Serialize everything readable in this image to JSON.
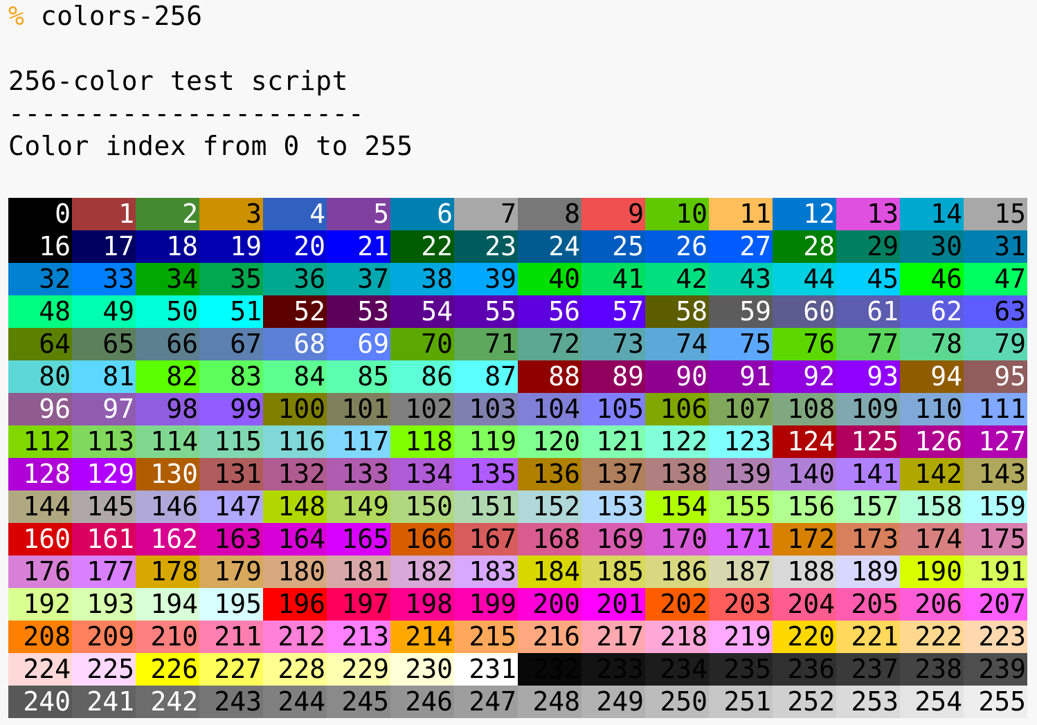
{
  "terminal": {
    "prompt_symbol": "%",
    "command": "colors-256",
    "heading": "256-color test script",
    "rule": "----------------------",
    "subheading": "Color index from 0 to 255"
  },
  "palette": {
    "prompt_color": "#f5a623",
    "colors": [
      "#000000",
      "#a33a3a",
      "#448a30",
      "#cc9000",
      "#3060c0",
      "#8040a0",
      "#0080b0",
      "#a8a8a8",
      "#787878",
      "#f05050",
      "#60c800",
      "#ffbe5a",
      "#0078d0",
      "#e050e0",
      "#00a8d0",
      "#a8a8a8",
      "#000000",
      "#000060",
      "#000098",
      "#0000b0",
      "#0000d8",
      "#0000ff",
      "#005c00",
      "#005c5c",
      "#005c90",
      "#005cc0",
      "#005ce0",
      "#005cff",
      "#008000",
      "#008060",
      "#008090",
      "#0080b0",
      "#0080d0",
      "#0080ff",
      "#00a800",
      "#00a850",
      "#00a890",
      "#00a8b0",
      "#00a8e0",
      "#00a8ff",
      "#00e000",
      "#00e060",
      "#00e080",
      "#00d0b0",
      "#00d0e0",
      "#00d0ff",
      "#00ff00",
      "#00ff60",
      "#00ff80",
      "#00ffb0",
      "#00ffd8",
      "#00ffff",
      "#5c0000",
      "#5c005c",
      "#5c0090",
      "#5c00b0",
      "#5c00e0",
      "#5c00ff",
      "#5c5c00",
      "#5c5c5c",
      "#5c5c90",
      "#5c5cb0",
      "#5c5ce0",
      "#5c5cff",
      "#5c8000",
      "#5c805c",
      "#5c8090",
      "#5c80b0",
      "#5c80d8",
      "#5c80ff",
      "#5ca800",
      "#5ca85c",
      "#5ca890",
      "#5ca8b0",
      "#5ca8d8",
      "#5ca8ff",
      "#5cd800",
      "#5cd85c",
      "#5cd890",
      "#5cd8b0",
      "#5cd8d8",
      "#5cd8ff",
      "#5cff00",
      "#5cff5c",
      "#5cff90",
      "#5cffb0",
      "#5cffd8",
      "#5cffff",
      "#900000",
      "#90005c",
      "#900090",
      "#9000b0",
      "#9000e0",
      "#9000ff",
      "#905c00",
      "#905c5c",
      "#905c90",
      "#905cb0",
      "#905ce0",
      "#905cff",
      "#808000",
      "#80805c",
      "#808080",
      "#8080b0",
      "#8080d8",
      "#8080ff",
      "#80a800",
      "#80a85c",
      "#80a880",
      "#80a8b0",
      "#80a8d8",
      "#80a8ff",
      "#80d800",
      "#80d85c",
      "#80d890",
      "#80d8b0",
      "#80d8d8",
      "#80d8ff",
      "#80ff00",
      "#80ff5c",
      "#80ff90",
      "#80ffb0",
      "#80ffd8",
      "#80ffff",
      "#b00000",
      "#b0005c",
      "#b00090",
      "#b000b0",
      "#b000d8",
      "#b000ff",
      "#b05c00",
      "#b05c5c",
      "#b05c90",
      "#b05cb0",
      "#b05cd8",
      "#b05cff",
      "#b08000",
      "#b0805c",
      "#b08080",
      "#b080b0",
      "#b080d8",
      "#b080ff",
      "#b0a800",
      "#b0a85c",
      "#b0a880",
      "#b0a8a8",
      "#b0a8d8",
      "#b0a8ff",
      "#b0d800",
      "#b0d85c",
      "#b0d880",
      "#b0d8b0",
      "#b0d8d8",
      "#b0d8ff",
      "#b0ff00",
      "#b0ff5c",
      "#b0ff90",
      "#b0ffb0",
      "#b0ffd8",
      "#b0ffff",
      "#d80000",
      "#d8005c",
      "#d80090",
      "#d800b0",
      "#d800d8",
      "#d800ff",
      "#d85c00",
      "#d85c5c",
      "#d85c90",
      "#d85cb0",
      "#d85cd8",
      "#d85cff",
      "#d88000",
      "#d8805c",
      "#d88080",
      "#d880b0",
      "#d880d8",
      "#d880ff",
      "#d8a800",
      "#d8a85c",
      "#d8a880",
      "#d8a8a8",
      "#d8a8d8",
      "#d8a8ff",
      "#d8d800",
      "#d8d85c",
      "#d8d880",
      "#d8d8b0",
      "#d8d8d8",
      "#d8d8ff",
      "#d8ff00",
      "#d8ff5c",
      "#d8ff90",
      "#d8ffb0",
      "#d8ffd8",
      "#d8ffff",
      "#ff0000",
      "#ff005c",
      "#ff0090",
      "#ff00b0",
      "#ff00d8",
      "#ff00ff",
      "#ff5c00",
      "#ff5c5c",
      "#ff5c90",
      "#ff5cb0",
      "#ff5cd8",
      "#ff5cff",
      "#ff8000",
      "#ff805c",
      "#ff8080",
      "#ff80b0",
      "#ff80d8",
      "#ff80ff",
      "#ffa800",
      "#ffa85c",
      "#ffa880",
      "#ffa8b0",
      "#ffa8d8",
      "#ffa8ff",
      "#ffd800",
      "#ffd85c",
      "#ffd890",
      "#ffd8b0",
      "#ffd8d8",
      "#ffd8ff",
      "#ffff00",
      "#ffff5c",
      "#ffff90",
      "#ffffb0",
      "#ffffd8",
      "#ffffff",
      "#080808",
      "#121212",
      "#1c1c1c",
      "#262626",
      "#303030",
      "#3a3a3a",
      "#444444",
      "#4e4e4e",
      "#585858",
      "#626262",
      "#6c6c6c",
      "#767676",
      "#808080",
      "#8a8a8a",
      "#949494",
      "#9e9e9e",
      "#a8a8a8",
      "#b2b2b2",
      "#bcbcbc",
      "#c6c6c6",
      "#d0d0d0",
      "#dadada",
      "#e4e4e4",
      "#eeeeee"
    ],
    "text_colors": [
      "#ffffff",
      "#ffffff",
      "#ffffff",
      "#000000",
      "#ffffff",
      "#ffffff",
      "#ffffff",
      "#000000",
      "#000000",
      "#000000",
      "#000000",
      "#000000",
      "#ffffff",
      "#000000",
      "#000000",
      "#000000",
      "#ffffff",
      "#ffffff",
      "#ffffff",
      "#ffffff",
      "#ffffff",
      "#ffffff",
      "#ffffff",
      "#ffffff",
      "#ffffff",
      "#ffffff",
      "#ffffff",
      "#ffffff",
      "#ffffff",
      "#000000",
      "#000000",
      "#000000",
      "#000000",
      "#000000",
      "#000000",
      "#000000",
      "#000000",
      "#000000",
      "#000000",
      "#000000",
      "#000000",
      "#000000",
      "#000000",
      "#000000",
      "#000000",
      "#000000",
      "#000000",
      "#000000",
      "#000000",
      "#000000",
      "#000000",
      "#000000",
      "#ffffff",
      "#ffffff",
      "#ffffff",
      "#ffffff",
      "#ffffff",
      "#ffffff",
      "#ffffff",
      "#ffffff",
      "#ffffff",
      "#ffffff",
      "#ffffff",
      "#000000",
      "#000000",
      "#000000",
      "#000000",
      "#000000",
      "#ffffff",
      "#ffffff",
      "#000000",
      "#000000",
      "#000000",
      "#000000",
      "#000000",
      "#000000",
      "#000000",
      "#000000",
      "#000000",
      "#000000",
      "#000000",
      "#000000",
      "#000000",
      "#000000",
      "#000000",
      "#000000",
      "#000000",
      "#000000",
      "#ffffff",
      "#ffffff",
      "#ffffff",
      "#ffffff",
      "#ffffff",
      "#ffffff",
      "#ffffff",
      "#ffffff",
      "#ffffff",
      "#ffffff",
      "#000000",
      "#000000",
      "#000000",
      "#000000",
      "#000000",
      "#000000",
      "#000000",
      "#000000",
      "#000000",
      "#000000",
      "#000000",
      "#000000",
      "#000000",
      "#000000",
      "#000000",
      "#000000",
      "#000000",
      "#000000",
      "#000000",
      "#000000",
      "#000000",
      "#000000",
      "#000000",
      "#000000",
      "#000000",
      "#000000",
      "#ffffff",
      "#ffffff",
      "#ffffff",
      "#ffffff",
      "#ffffff",
      "#ffffff",
      "#ffffff",
      "#000000",
      "#000000",
      "#000000",
      "#000000",
      "#000000",
      "#000000",
      "#000000",
      "#000000",
      "#000000",
      "#000000",
      "#000000",
      "#000000",
      "#000000",
      "#000000",
      "#000000",
      "#000000",
      "#000000",
      "#000000",
      "#000000",
      "#000000",
      "#000000",
      "#000000",
      "#000000",
      "#000000",
      "#000000",
      "#000000",
      "#000000",
      "#000000",
      "#000000",
      "#ffffff",
      "#ffffff",
      "#ffffff",
      "#000000",
      "#000000",
      "#000000",
      "#000000",
      "#000000",
      "#000000",
      "#000000",
      "#000000",
      "#000000",
      "#000000",
      "#000000",
      "#000000",
      "#000000",
      "#000000",
      "#000000",
      "#000000",
      "#000000",
      "#000000",
      "#000000",
      "#000000",
      "#000000",
      "#000000",
      "#000000",
      "#000000",
      "#000000",
      "#000000",
      "#000000",
      "#000000",
      "#000000",
      "#000000",
      "#000000",
      "#000000",
      "#000000",
      "#000000",
      "#000000",
      "#000000",
      "#000000",
      "#000000",
      "#000000",
      "#000000",
      "#000000",
      "#000000",
      "#000000",
      "#000000",
      "#000000",
      "#000000",
      "#000000",
      "#000000",
      "#000000",
      "#000000",
      "#000000",
      "#000000",
      "#000000",
      "#000000",
      "#000000",
      "#000000",
      "#000000",
      "#000000",
      "#000000",
      "#000000",
      "#000000",
      "#000000",
      "#000000",
      "#000000",
      "#000000",
      "#000000",
      "#000000",
      "#000000",
      "#000000",
      "#000000",
      "#000000",
      "#000000",
      "#000000",
      "#000000",
      "#000000",
      "#000000",
      "#000000",
      "#ffffff",
      "#ffffff",
      "#ffffff",
      "#000000",
      "#000000",
      "#000000",
      "#000000",
      "#000000",
      "#000000",
      "#000000",
      "#000000",
      "#000000",
      "#000000",
      "#000000",
      "#000000",
      "#000000"
    ]
  }
}
